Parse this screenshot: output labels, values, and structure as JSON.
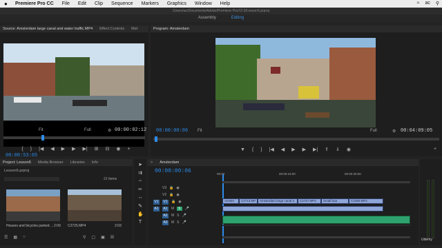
{
  "menubar": {
    "apple": "",
    "app": "Premiere Pro CC",
    "items": [
      "File",
      "Edit",
      "Clip",
      "Sequence",
      "Markers",
      "Graphics",
      "Window",
      "Help"
    ],
    "right": [
      "ac"
    ]
  },
  "titlebar": {
    "path": "/Users/ac/Documents/Adobe/Premiere Pro/12.0/Lesson5.prproj"
  },
  "workspaces": {
    "tabs": [
      "Assembly",
      "Editing"
    ],
    "active": "Editing"
  },
  "source": {
    "tab_label": "Source: Amsterdam large canal and water traffic.MP4",
    "other_tabs": [
      "Effect Controls",
      "Met"
    ],
    "timecode_left": "00:00:53:05",
    "fit": "Fit",
    "quality": "Full",
    "timecode_right": "00:00:02:12"
  },
  "program": {
    "tab_label": "Program: Amsterdam",
    "timecode_left": "00:00:00:06",
    "fit": "Fit",
    "quality": "Full",
    "timecode_right": "00:04:09:05"
  },
  "project": {
    "tab_label": "Project: Lesson5",
    "other_tabs": [
      "Media Browser",
      "Libraries",
      "Info"
    ],
    "file": "Lesson5.prproj",
    "items_count": "21 Items",
    "clips": [
      {
        "name": "Houses and bicycles parked ...",
        "duration": "2:09"
      },
      {
        "name": "C2725.MP4",
        "duration": "2:03"
      }
    ]
  },
  "timeline": {
    "tab_label": "Amsterdam",
    "timecode": "00:00:00:06",
    "ruler": [
      "00:00",
      "00:00:15:00",
      "00:00:30:00"
    ],
    "video_tracks": [
      "V3",
      "V2",
      "V1"
    ],
    "audio_tracks": [
      "A1",
      "A2",
      "A3"
    ],
    "clips_v1": [
      "Amster",
      "C2713.MP",
      "Amsterdam large canal a",
      "C2727.MP4",
      "Small boa",
      "C2480.MP4"
    ]
  },
  "colors": {
    "accent": "#2d8ceb",
    "clip": "#8ea5d8",
    "audio": "#2ea26f"
  }
}
